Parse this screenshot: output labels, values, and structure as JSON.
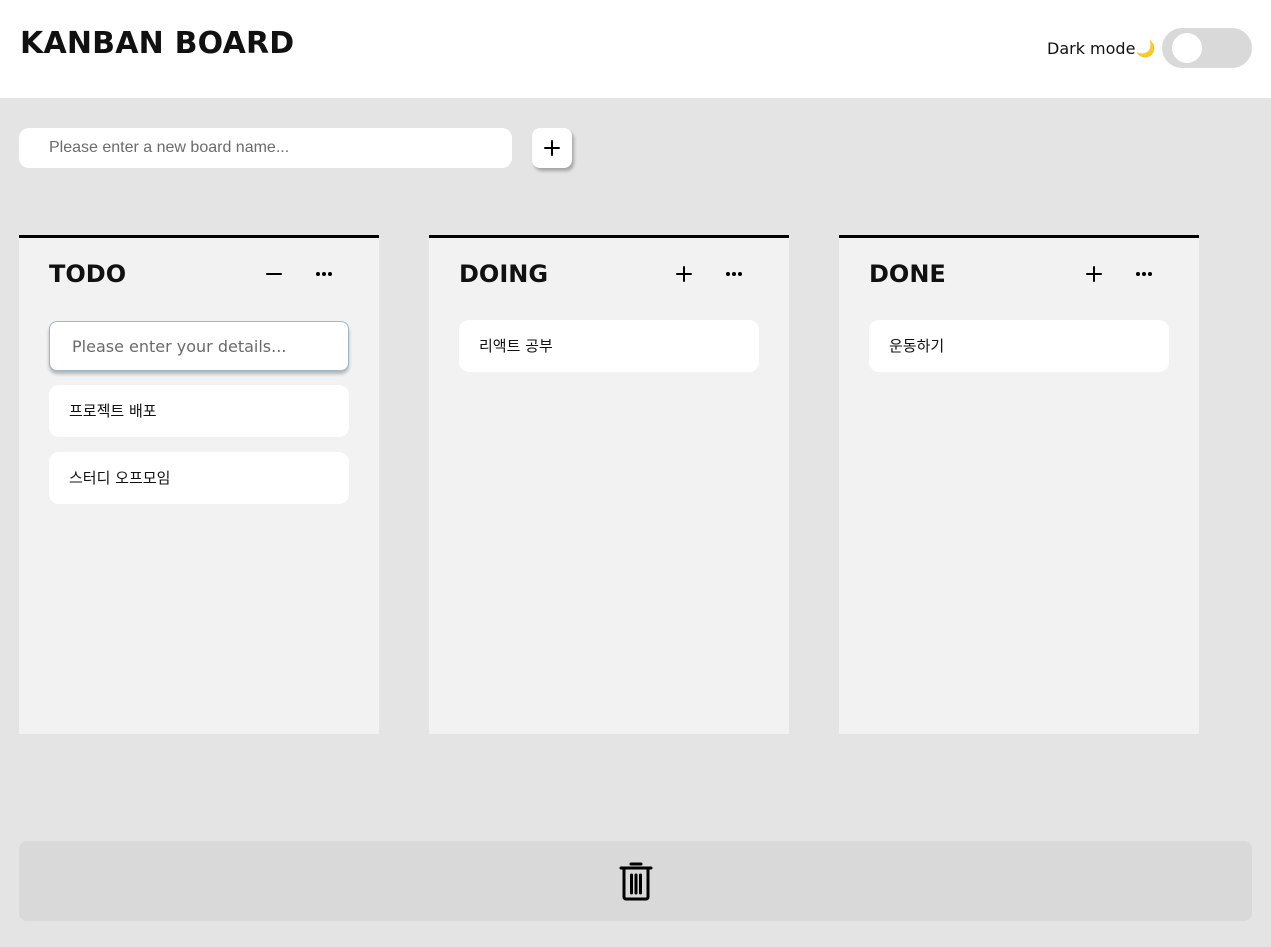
{
  "header": {
    "title": "KANBAN BOARD",
    "dark_mode_label": "Dark mode",
    "dark_mode_emoji": "🌙",
    "dark_mode_on": false
  },
  "new_board": {
    "placeholder": "Please enter a new board name...",
    "value": "",
    "add_icon": "plus-icon"
  },
  "boards": [
    {
      "title": "TODO",
      "action_icon": "minus-icon",
      "menu_icon": "more-horizontal-icon",
      "input_open": true,
      "input_placeholder": "Please enter your details...",
      "cards": [
        "프로젝트 배포",
        "스터디 오프모임"
      ]
    },
    {
      "title": "DOING",
      "action_icon": "plus-icon",
      "menu_icon": "more-horizontal-icon",
      "input_open": false,
      "cards": [
        "리액트 공부"
      ]
    },
    {
      "title": "DONE",
      "action_icon": "plus-icon",
      "menu_icon": "more-horizontal-icon",
      "input_open": false,
      "cards": [
        "운동하기"
      ]
    }
  ],
  "trash": {
    "icon": "trash-icon"
  },
  "colors": {
    "background": "#e4e4e4",
    "header": "#ffffff",
    "board": "#f2f2f2",
    "card": "#ffffff",
    "trash_zone": "#d9d9d9",
    "toggle_track": "#d9d9d9",
    "board_border": "#000000"
  }
}
